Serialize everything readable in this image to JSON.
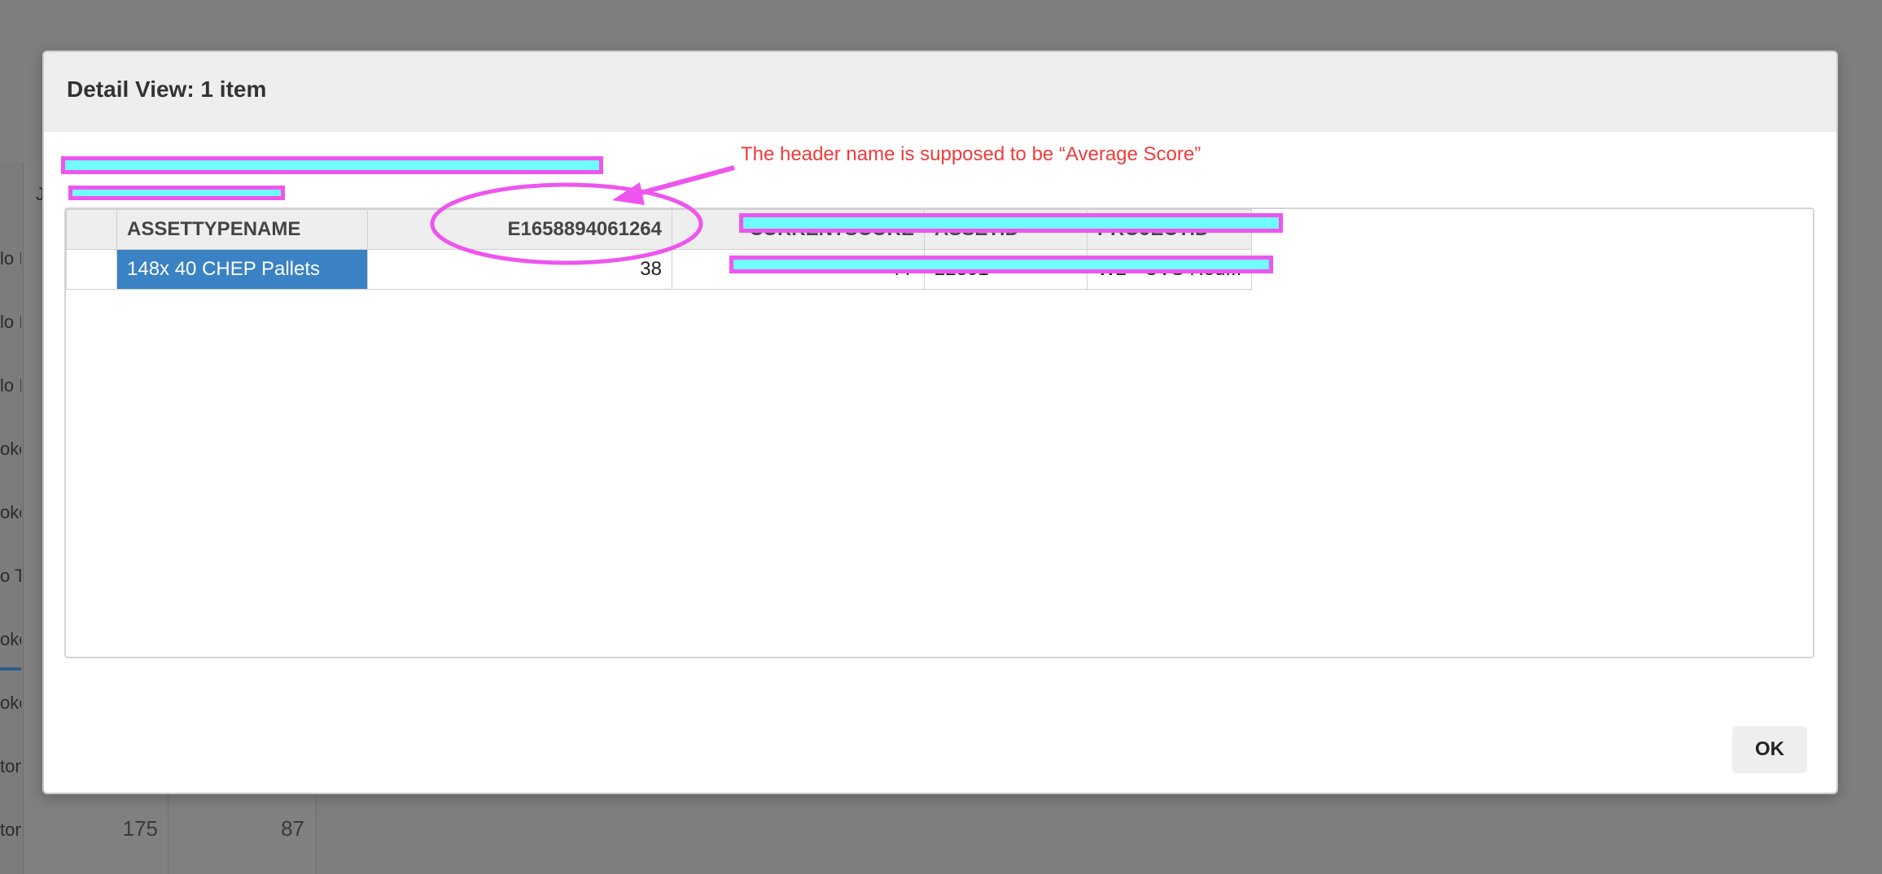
{
  "background": {
    "row_snippets": [
      "lo I",
      "lo I",
      "lo I",
      "oke",
      "oke",
      "o T",
      "oke",
      "oke",
      "ton",
      "ton"
    ],
    "header_snippet": "J",
    "numbers": [
      "175",
      "87"
    ]
  },
  "modal": {
    "title": "Detail View: 1 item",
    "table": {
      "columns": [
        "",
        "ASSETTYPENAME",
        "E1658894061264",
        "CURRENTSCORE",
        "ASSETID",
        "PROJECTID"
      ],
      "rows": [
        {
          "rowhead": "",
          "assettypename": "148x 40 CHEP Pallets",
          "value": "38",
          "current": "77",
          "assetid": "22301",
          "projectid": "W2 - CVS Red..."
        }
      ]
    },
    "ok_label": "OK"
  },
  "annotation": {
    "text": "The header name is supposed to be “Average Score”",
    "color": "#ef3b3b",
    "highlight_color": "#ee55ee",
    "redaction_fill": "#6ffbff"
  }
}
